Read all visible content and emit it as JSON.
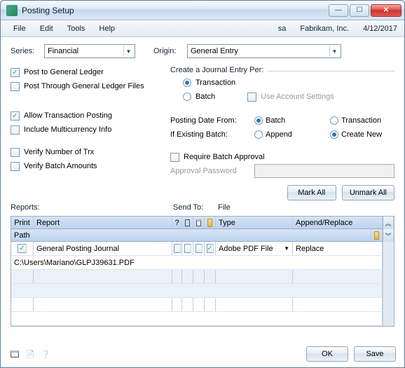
{
  "window": {
    "title": "Posting Setup"
  },
  "menu": {
    "file": "File",
    "edit": "Edit",
    "tools": "Tools",
    "help": "Help"
  },
  "status": {
    "user": "sa",
    "company": "Fabrikam, Inc.",
    "date": "4/12/2017"
  },
  "filters": {
    "series_label": "Series:",
    "series_value": "Financial",
    "origin_label": "Origin:",
    "origin_value": "General Entry"
  },
  "left": {
    "post_gl": "Post to General Ledger",
    "post_through": "Post Through General Ledger Files",
    "allow_trx": "Allow Transaction Posting",
    "include_mc": "Include Multicurrency Info",
    "verify_num": "Verify Number of Trx",
    "verify_amt": "Verify Batch Amounts"
  },
  "journal": {
    "legend": "Create a Journal Entry Per:",
    "transaction": "Transaction",
    "batch": "Batch",
    "use_acct": "Use Account Settings"
  },
  "posting": {
    "date_from": "Posting Date From:",
    "if_existing": "If Existing Batch:",
    "batch": "Batch",
    "transaction": "Transaction",
    "append": "Append",
    "create_new": "Create New"
  },
  "approval": {
    "require": "Require Batch Approval",
    "pwd_label": "Approval Password"
  },
  "buttons": {
    "mark_all": "Mark All",
    "unmark_all": "Unmark All",
    "ok": "OK",
    "save": "Save"
  },
  "grid": {
    "reports": "Reports:",
    "sendto": "Send To:",
    "file": "File",
    "print": "Print",
    "report": "Report",
    "type": "Type",
    "append_replace": "Append/Replace",
    "path": "Path",
    "row_report": "General Posting Journal",
    "row_type": "Adobe PDF File",
    "row_ar": "Replace",
    "row_path": "C:\\Users\\Mariano\\GLPJ39631.PDF"
  }
}
